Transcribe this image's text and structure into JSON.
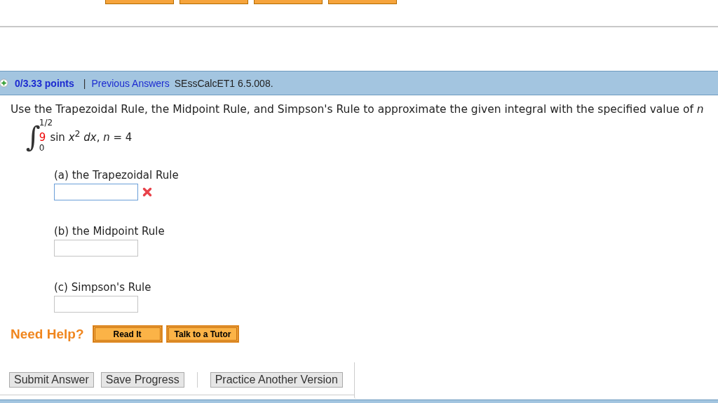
{
  "top_strip": {
    "buttons": [
      {
        "kind": "orange"
      },
      {
        "kind": "orange"
      },
      {
        "kind": "orange"
      },
      {
        "kind": "orange"
      }
    ]
  },
  "header": {
    "points": "0/3.33 points",
    "separator": "|",
    "previous_answers": "Previous Answers",
    "problem_id": "SEssCalcET1 6.5.008."
  },
  "question": "Use the Trapezoidal Rule, the Midpoint Rule, and Simpson's Rule to approximate the given integral with the specified value of *n*",
  "integral": {
    "sign": "∫",
    "upper": "1/2",
    "lower": "0",
    "coefficient": "9",
    "integrand": "sin *x*$^{2}$ *dx*, *n* = 4"
  },
  "parts": [
    {
      "label": "(a) the Trapezoidal Rule",
      "marked_wrong": true,
      "focused": true
    },
    {
      "label": "(b) the Midpoint Rule",
      "marked_wrong": false,
      "focused": false
    },
    {
      "label": "(c) Simpson's Rule",
      "marked_wrong": false,
      "focused": false
    }
  ],
  "help": {
    "label": "Need Help?",
    "buttons": [
      "Read It",
      "Talk to a Tutor"
    ]
  },
  "actions": {
    "left": [
      "Submit Answer",
      "Save Progress"
    ],
    "right": [
      "Practice Another Version"
    ]
  }
}
